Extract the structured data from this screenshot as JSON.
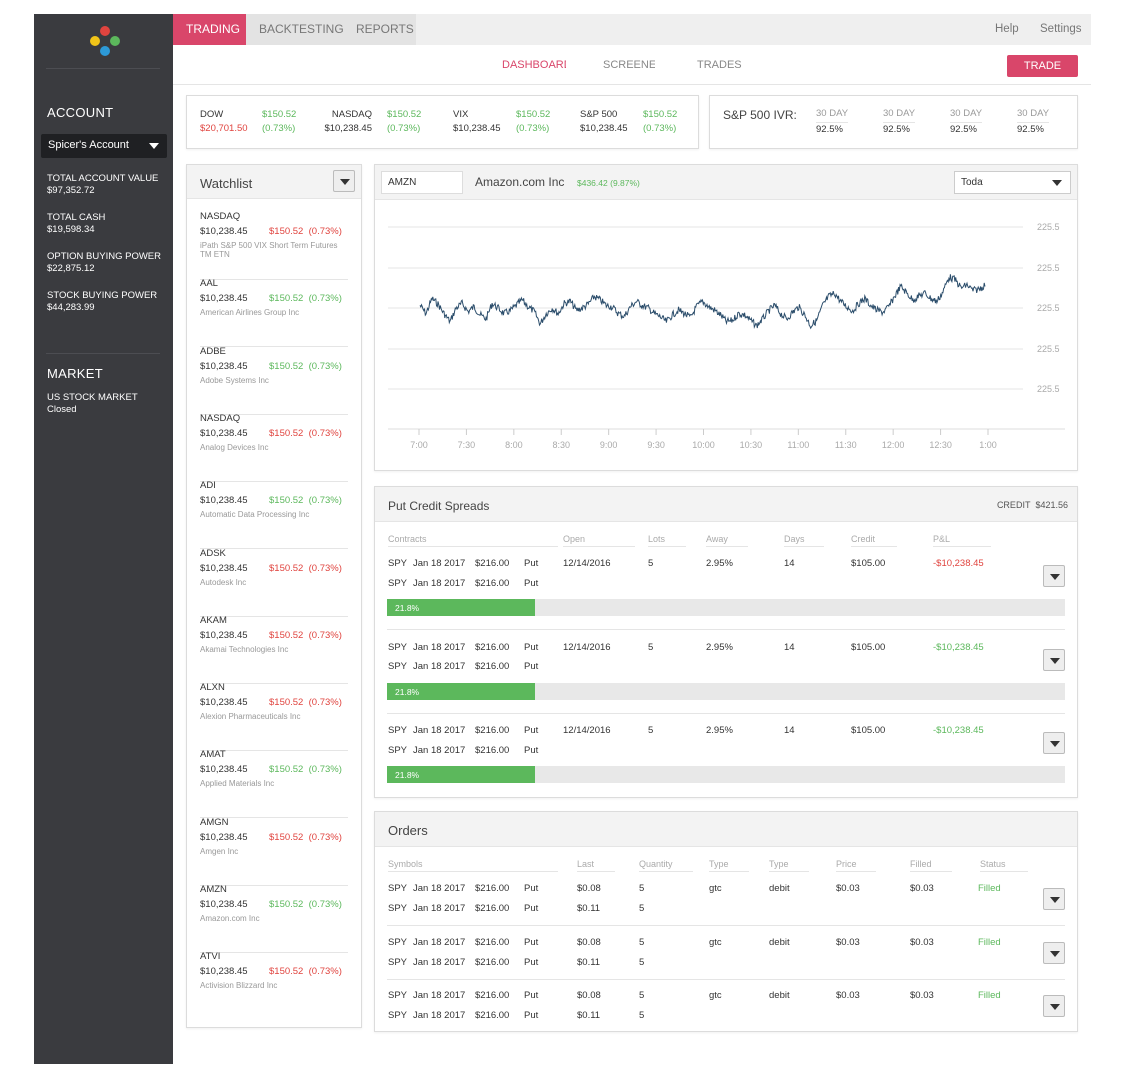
{
  "nav": {
    "tabs": [
      "TRADING",
      "BACKTESTING",
      "REPORTS"
    ],
    "help": "Help",
    "settings": "Settings",
    "subtabs": [
      "DASHBOARD",
      "SCREENER",
      "TRADES"
    ],
    "trade_button": "TRADE"
  },
  "sidebar": {
    "account_heading": "ACCOUNT",
    "account_select": "Spicer's Account",
    "stats": [
      {
        "label": "TOTAL ACCOUNT VALUE",
        "value": "$97,352.72"
      },
      {
        "label": "TOTAL CASH",
        "value": "$19,598.34"
      },
      {
        "label": "OPTION BUYING POWER",
        "value": "$22,875.12"
      },
      {
        "label": "STOCK BUYING POWER",
        "value": "$44,283.99"
      }
    ],
    "market_heading": "MARKET",
    "market_label": "US STOCK MARKET",
    "market_status": "Closed"
  },
  "indices": [
    {
      "name": "DOW",
      "value": "$20,701.50",
      "change": "$150.52",
      "pct": "(0.73%)"
    },
    {
      "name": "NASDAQ",
      "value": "$10,238.45",
      "change": "$150.52",
      "pct": "(0.73%)"
    },
    {
      "name": "VIX",
      "value": "$10,238.45",
      "change": "$150.52",
      "pct": "(0.73%)"
    },
    {
      "name": "S&P 500",
      "value": "$10,238.45",
      "change": "$150.52",
      "pct": "(0.73%)"
    }
  ],
  "ivr": {
    "label": "S&P 500 IVR:",
    "cols": [
      {
        "head": "30 DAY",
        "value": "92.5%"
      },
      {
        "head": "30 DAY",
        "value": "92.5%"
      },
      {
        "head": "30 DAY",
        "value": "92.5%"
      },
      {
        "head": "30 DAY",
        "value": "92.5%"
      }
    ]
  },
  "watchlist": {
    "title": "Watchlist",
    "items": [
      {
        "symbol": "NASDAQ",
        "price": "$10,238.45",
        "change": "$150.52  (0.73%)",
        "dir": "down",
        "company": "iPath S&P 500 VIX Short Term Futures TM ETN"
      },
      {
        "symbol": "AAL",
        "price": "$10,238.45",
        "change": "$150.52  (0.73%)",
        "dir": "up",
        "company": "American Airlines Group Inc"
      },
      {
        "symbol": "ADBE",
        "price": "$10,238.45",
        "change": "$150.52  (0.73%)",
        "dir": "up",
        "company": "Adobe Systems Inc"
      },
      {
        "symbol": "NASDAQ",
        "price": "$10,238.45",
        "change": "$150.52  (0.73%)",
        "dir": "down",
        "company": "Analog Devices Inc"
      },
      {
        "symbol": "ADI",
        "price": "$10,238.45",
        "change": "$150.52  (0.73%)",
        "dir": "up",
        "company": "Automatic Data Processing Inc"
      },
      {
        "symbol": "ADSK",
        "price": "$10,238.45",
        "change": "$150.52  (0.73%)",
        "dir": "down",
        "company": "Autodesk Inc"
      },
      {
        "symbol": "AKAM",
        "price": "$10,238.45",
        "change": "$150.52  (0.73%)",
        "dir": "down",
        "company": "Akamai Technologies Inc"
      },
      {
        "symbol": "ALXN",
        "price": "$10,238.45",
        "change": "$150.52  (0.73%)",
        "dir": "down",
        "company": "Alexion Pharmaceuticals Inc"
      },
      {
        "symbol": "AMAT",
        "price": "$10,238.45",
        "change": "$150.52  (0.73%)",
        "dir": "up",
        "company": "Applied Materials Inc"
      },
      {
        "symbol": "AMGN",
        "price": "$10,238.45",
        "change": "$150.52  (0.73%)",
        "dir": "down",
        "company": "Amgen Inc"
      },
      {
        "symbol": "AMZN",
        "price": "$10,238.45",
        "change": "$150.52  (0.73%)",
        "dir": "up",
        "company": "Amazon.com Inc"
      },
      {
        "symbol": "ATVI",
        "price": "$10,238.45",
        "change": "$150.52  (0.73%)",
        "dir": "down",
        "company": "Activision Blizzard Inc"
      }
    ]
  },
  "chart": {
    "symbol": "AMZN",
    "company": "Amazon.com Inc",
    "price": "$436.42",
    "pct": "(9.87%)",
    "range": "Today"
  },
  "chart_data": {
    "type": "line",
    "x_ticks": [
      "7:00",
      "7:30",
      "8:00",
      "8:30",
      "9:00",
      "9:30",
      "10:00",
      "10:30",
      "11:00",
      "11:30",
      "12:00",
      "12:30",
      "1:00"
    ],
    "y_ticks": [
      "225.5",
      "225.5",
      "225.5",
      "225.5",
      "225.5"
    ],
    "series": [
      {
        "values": [
          0.42,
          0.3,
          0.52,
          0.44,
          0.3,
          0.18,
          0.38,
          0.45,
          0.33,
          0.4,
          0.28,
          0.22,
          0.45,
          0.38,
          0.3,
          0.34,
          0.42,
          0.5,
          0.4,
          0.33,
          0.15,
          0.3,
          0.38,
          0.3,
          0.45,
          0.48,
          0.35,
          0.38,
          0.44,
          0.55,
          0.5,
          0.42,
          0.4,
          0.3,
          0.26,
          0.4,
          0.48,
          0.42,
          0.38,
          0.3,
          0.25,
          0.18,
          0.28,
          0.35,
          0.3,
          0.24,
          0.4,
          0.48,
          0.4,
          0.35,
          0.28,
          0.18,
          0.2,
          0.3,
          0.28,
          0.2,
          0.12,
          0.22,
          0.34,
          0.42,
          0.3,
          0.22,
          0.32,
          0.4,
          0.28,
          0.12,
          0.2,
          0.42,
          0.55,
          0.6,
          0.48,
          0.4,
          0.34,
          0.45,
          0.52,
          0.42,
          0.35,
          0.32,
          0.4,
          0.56,
          0.7,
          0.6,
          0.5,
          0.56,
          0.6,
          0.52,
          0.48,
          0.62,
          0.84,
          0.8,
          0.68,
          0.72,
          0.64,
          0.66,
          0.72
        ]
      }
    ]
  },
  "put_credit_spreads": {
    "title": "Put Credit Spreads",
    "credit_label": "CREDIT",
    "credit_value": "$421.56",
    "headers": [
      "Contracts",
      "Open",
      "Lots",
      "Away",
      "Days",
      "Credit",
      "P&L"
    ],
    "rows": [
      {
        "legs": [
          {
            "sym": "SPY",
            "date": "Jan 18 2017",
            "strike": "$216.00",
            "type": "Put"
          },
          {
            "sym": "SPY",
            "date": "Jan 18 2017",
            "strike": "$216.00",
            "type": "Put"
          }
        ],
        "open": "12/14/2016",
        "lots": "5",
        "away": "2.95%",
        "days": "14",
        "credit": "$105.00",
        "pl": "-$10,238.45",
        "pl_dir": "down",
        "progress": 21.8,
        "progress_label": "21.8%"
      },
      {
        "legs": [
          {
            "sym": "SPY",
            "date": "Jan 18 2017",
            "strike": "$216.00",
            "type": "Put"
          },
          {
            "sym": "SPY",
            "date": "Jan 18 2017",
            "strike": "$216.00",
            "type": "Put"
          }
        ],
        "open": "12/14/2016",
        "lots": "5",
        "away": "2.95%",
        "days": "14",
        "credit": "$105.00",
        "pl": "-$10,238.45",
        "pl_dir": "up",
        "progress": 21.8,
        "progress_label": "21.8%"
      },
      {
        "legs": [
          {
            "sym": "SPY",
            "date": "Jan 18 2017",
            "strike": "$216.00",
            "type": "Put"
          },
          {
            "sym": "SPY",
            "date": "Jan 18 2017",
            "strike": "$216.00",
            "type": "Put"
          }
        ],
        "open": "12/14/2016",
        "lots": "5",
        "away": "2.95%",
        "days": "14",
        "credit": "$105.00",
        "pl": "-$10,238.45",
        "pl_dir": "up",
        "progress": 21.8,
        "progress_label": "21.8%"
      }
    ]
  },
  "orders": {
    "title": "Orders",
    "headers": [
      "Symbols",
      "Last",
      "Quantity",
      "Type",
      "Type",
      "Price",
      "Filled",
      "Status"
    ],
    "rows": [
      {
        "legs": [
          {
            "sym": "SPY",
            "date": "Jan 18 2017",
            "strike": "$216.00",
            "type": "Put",
            "last": "$0.08",
            "qty": "5"
          },
          {
            "sym": "SPY",
            "date": "Jan 18 2017",
            "strike": "$216.00",
            "type": "Put",
            "last": "$0.11",
            "qty": "5"
          }
        ],
        "type1": "gtc",
        "type2": "debit",
        "price": "$0.03",
        "filled": "$0.03",
        "status": "Filled"
      },
      {
        "legs": [
          {
            "sym": "SPY",
            "date": "Jan 18 2017",
            "strike": "$216.00",
            "type": "Put",
            "last": "$0.08",
            "qty": "5"
          },
          {
            "sym": "SPY",
            "date": "Jan 18 2017",
            "strike": "$216.00",
            "type": "Put",
            "last": "$0.11",
            "qty": "5"
          }
        ],
        "type1": "gtc",
        "type2": "debit",
        "price": "$0.03",
        "filled": "$0.03",
        "status": "Filled"
      },
      {
        "legs": [
          {
            "sym": "SPY",
            "date": "Jan 18 2017",
            "strike": "$216.00",
            "type": "Put",
            "last": "$0.08",
            "qty": "5"
          },
          {
            "sym": "SPY",
            "date": "Jan 18 2017",
            "strike": "$216.00",
            "type": "Put",
            "last": "$0.11",
            "qty": "5"
          }
        ],
        "type1": "gtc",
        "type2": "debit",
        "price": "$0.03",
        "filled": "$0.03",
        "status": "Filled"
      }
    ]
  },
  "colors": {
    "accent": "#d9466a",
    "up": "#5cb85c",
    "down": "#e0443f",
    "sidebar": "#3a3b3f",
    "chart_line": "#2b4d6b"
  },
  "icons": {
    "logo": "four-dot-logo-icon",
    "dropdown": "chevron-down-icon"
  }
}
